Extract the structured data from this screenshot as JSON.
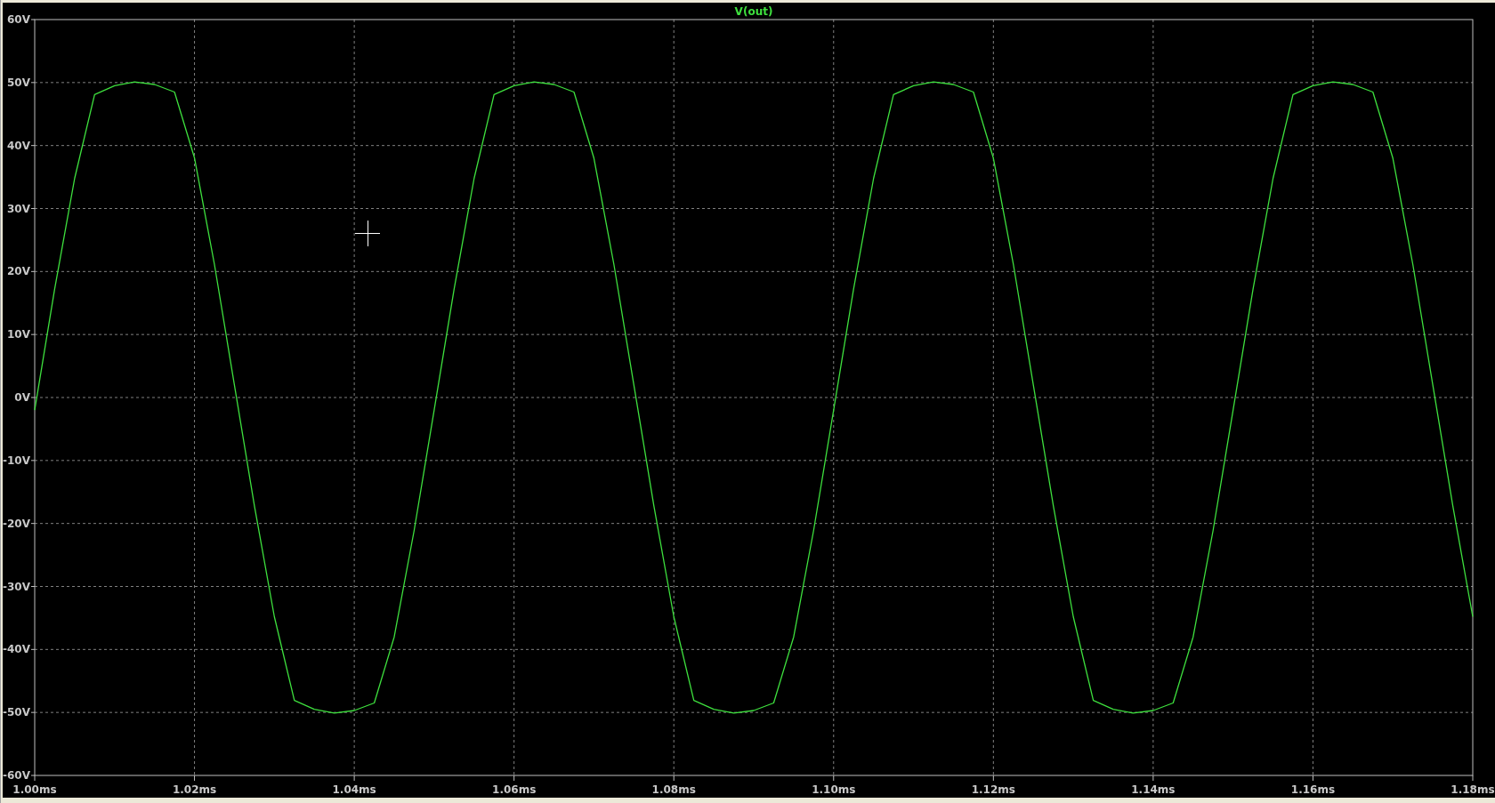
{
  "waveform_viewer": {
    "chart_data": {
      "type": "line",
      "x": [
        1.0,
        1.0025,
        1.005,
        1.0075,
        1.01,
        1.0125,
        1.015,
        1.0175,
        1.02,
        1.0225,
        1.025,
        1.0275,
        1.03,
        1.0325,
        1.035,
        1.0375,
        1.04,
        1.0425,
        1.045,
        1.0475,
        1.05,
        1.0525,
        1.055,
        1.0575,
        1.06,
        1.0625,
        1.065,
        1.0675,
        1.07,
        1.0725,
        1.075,
        1.0775,
        1.08,
        1.0825,
        1.085,
        1.0875,
        1.09,
        1.0925,
        1.095,
        1.0975,
        1.1,
        1.1025,
        1.105,
        1.1075,
        1.11,
        1.1125,
        1.115,
        1.1175,
        1.12,
        1.1225,
        1.125,
        1.1275,
        1.13,
        1.1325,
        1.135,
        1.1375,
        1.14,
        1.1425,
        1.145,
        1.1475,
        1.15,
        1.1525,
        1.155,
        1.1575,
        1.16,
        1.1625,
        1.165,
        1.1675,
        1.17,
        1.1725,
        1.175,
        1.1775,
        1.18
      ],
      "series": [
        {
          "name": "V(out)",
          "color": "#3ee03e",
          "values": [
            -2.0,
            17.2,
            34.8,
            48.1,
            49.5,
            50.1,
            49.7,
            48.5,
            38.0,
            21.1,
            2.0,
            -17.2,
            -34.8,
            -48.1,
            -49.5,
            -50.1,
            -49.7,
            -48.5,
            -38.0,
            -21.1,
            -2.0,
            17.2,
            34.8,
            48.1,
            49.5,
            50.1,
            49.7,
            48.5,
            38.0,
            21.1,
            2.0,
            -17.2,
            -34.8,
            -48.1,
            -49.5,
            -50.1,
            -49.7,
            -48.5,
            -38.0,
            -21.1,
            -2.0,
            17.2,
            34.8,
            48.1,
            49.5,
            50.1,
            49.7,
            48.5,
            38.0,
            21.1,
            2.0,
            -17.2,
            -34.8,
            -48.1,
            -49.5,
            -50.1,
            -49.7,
            -48.5,
            -38.0,
            -21.1,
            -2.0,
            17.2,
            34.8,
            48.1,
            49.5,
            50.1,
            49.7,
            48.5,
            38.0,
            21.1,
            2.0,
            -17.2,
            -34.8
          ]
        }
      ],
      "grid": true,
      "xlim": [
        1.0,
        1.18
      ],
      "ylim": [
        -60,
        60
      ],
      "xticks": [
        {
          "value": 1.0,
          "label": "1.00ms"
        },
        {
          "value": 1.02,
          "label": "1.02ms"
        },
        {
          "value": 1.04,
          "label": "1.04ms"
        },
        {
          "value": 1.06,
          "label": "1.06ms"
        },
        {
          "value": 1.08,
          "label": "1.08ms"
        },
        {
          "value": 1.1,
          "label": "1.10ms"
        },
        {
          "value": 1.12,
          "label": "1.12ms"
        },
        {
          "value": 1.14,
          "label": "1.14ms"
        },
        {
          "value": 1.16,
          "label": "1.16ms"
        },
        {
          "value": 1.18,
          "label": "1.18ms"
        }
      ],
      "yticks": [
        {
          "value": 60,
          "label": "60V"
        },
        {
          "value": 50,
          "label": "50V"
        },
        {
          "value": 40,
          "label": "40V"
        },
        {
          "value": 30,
          "label": "30V"
        },
        {
          "value": 20,
          "label": "20V"
        },
        {
          "value": 10,
          "label": "10V"
        },
        {
          "value": 0,
          "label": "0V"
        },
        {
          "value": -10,
          "label": "-10V"
        },
        {
          "value": -20,
          "label": "-20V"
        },
        {
          "value": -30,
          "label": "-30V"
        },
        {
          "value": -40,
          "label": "-40V"
        },
        {
          "value": -50,
          "label": "-50V"
        },
        {
          "value": -60,
          "label": "-60V"
        }
      ]
    }
  }
}
